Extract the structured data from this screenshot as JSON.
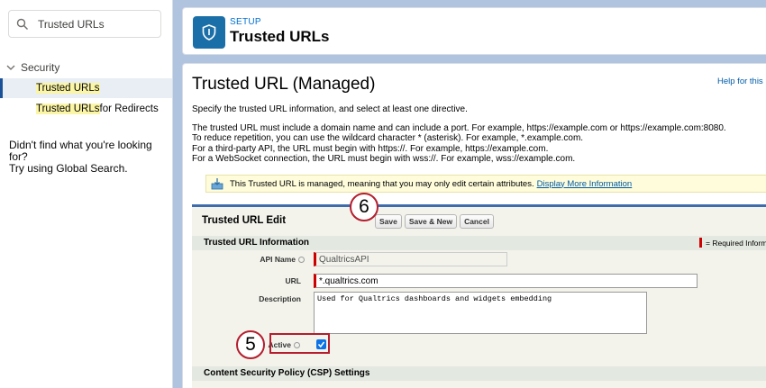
{
  "sidebar": {
    "search_value": "Trusted URLs",
    "group_label": "Security",
    "items": [
      {
        "highlight": "Trusted URLs",
        "rest": ""
      },
      {
        "highlight": "Trusted URLs",
        "rest": " for Redirects"
      }
    ],
    "not_found_line1": "Didn't find what you're looking for?",
    "not_found_line2": "Try using Global Search."
  },
  "header": {
    "setup_label": "SETUP",
    "title": "Trusted URLs"
  },
  "main": {
    "page_title": "Trusted URL (Managed)",
    "help_link": "Help for this Pa",
    "intro": "Specify the trusted URL information, and select at least one directive.",
    "details": [
      "The trusted URL must include a domain name and can include a port. For example, https://example.com or https://example.com:8080.",
      "To reduce repetition, you can use the wildcard character * (asterisk). For example, *.example.com.",
      "For a third-party API, the URL must begin with https://. For example, https://example.com.",
      "For a WebSocket connection, the URL must begin with wss://. For example, wss://example.com."
    ],
    "info_text": "This Trusted URL is managed, meaning that you may only edit certain attributes.",
    "info_link": "Display More Information"
  },
  "edit": {
    "title": "Trusted URL Edit",
    "buttons": {
      "save": "Save",
      "save_new": "Save & New",
      "cancel": "Cancel"
    },
    "section_info": "Trusted URL Information",
    "required_legend": "= Required Informa",
    "fields": {
      "api_name_label": "API Name",
      "api_name_value": "QualtricsAPI",
      "url_label": "URL",
      "url_value": "*.qualtrics.com",
      "description_label": "Description",
      "description_value": "Used for Qualtrics dashboards and widgets embedding",
      "active_label": "Active"
    },
    "section_csp": "Content Security Policy (CSP) Settings"
  },
  "annotations": {
    "step5": "5",
    "step6": "6"
  },
  "colors": {
    "brand_blue": "#1b6fa8",
    "highlight": "#fbf5a6",
    "annotation_red": "#b41e2e",
    "checkbox": "#0b72e7"
  }
}
